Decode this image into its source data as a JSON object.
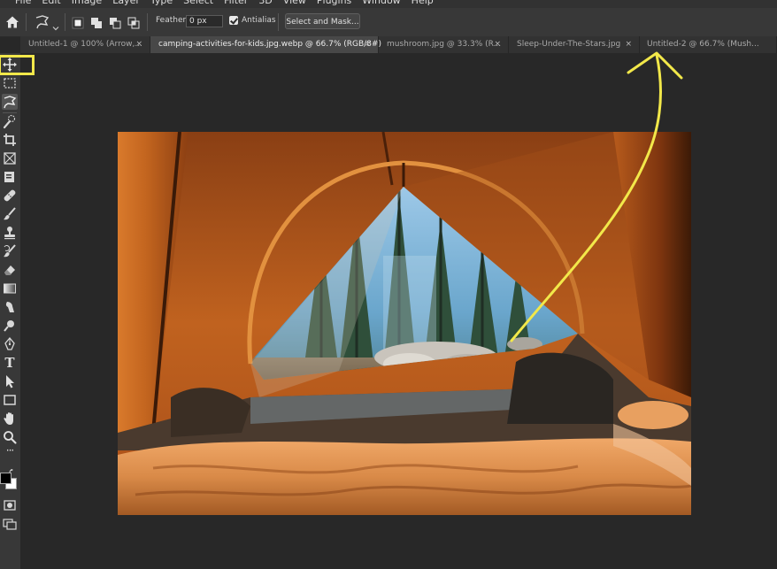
{
  "menu": {
    "items": [
      "File",
      "Edit",
      "Image",
      "Layer",
      "Type",
      "Select",
      "Filter",
      "3D",
      "View",
      "Plugins",
      "Window",
      "Help"
    ]
  },
  "options": {
    "feather_label": "Feather:",
    "feather_value": "0 px",
    "antialias_label": "Antialias",
    "antialias_checked": true,
    "select_mask_label": "Select and Mask..."
  },
  "tabs": [
    {
      "label": "Untitled-1 @ 100% (Arrow,...",
      "active": false
    },
    {
      "label": "camping-activities-for-kids.jpg.webp @ 66.7% (RGB/8#)",
      "active": true
    },
    {
      "label": "mushroom.jpg @ 33.3% (R...",
      "active": false
    },
    {
      "label": "Sleep-Under-The-Stars.jpg",
      "active": false
    },
    {
      "label": "Untitled-2 @ 66.7% (Mush...",
      "active": false
    }
  ],
  "tab_close_glyph": "×",
  "toolbar": {
    "tools": [
      "move-tool",
      "marquee-tool",
      "lasso-tool",
      "quick-selection-tool",
      "crop-tool",
      "frame-tool",
      "eyedropper-tool",
      "healing-brush-tool",
      "brush-tool",
      "clone-stamp-tool",
      "history-brush-tool",
      "eraser-tool",
      "gradient-tool",
      "blur-tool",
      "dodge-tool",
      "pen-tool",
      "type-tool",
      "path-selection-tool",
      "rectangle-tool",
      "hand-tool",
      "zoom-tool",
      "more-tools"
    ],
    "type_tool_glyph": "T",
    "more_glyph": "···"
  },
  "colors": {
    "foreground": "#000000",
    "background": "#ffffff",
    "annotation": "#f2e84a",
    "tent_orange": "#b3571d"
  }
}
